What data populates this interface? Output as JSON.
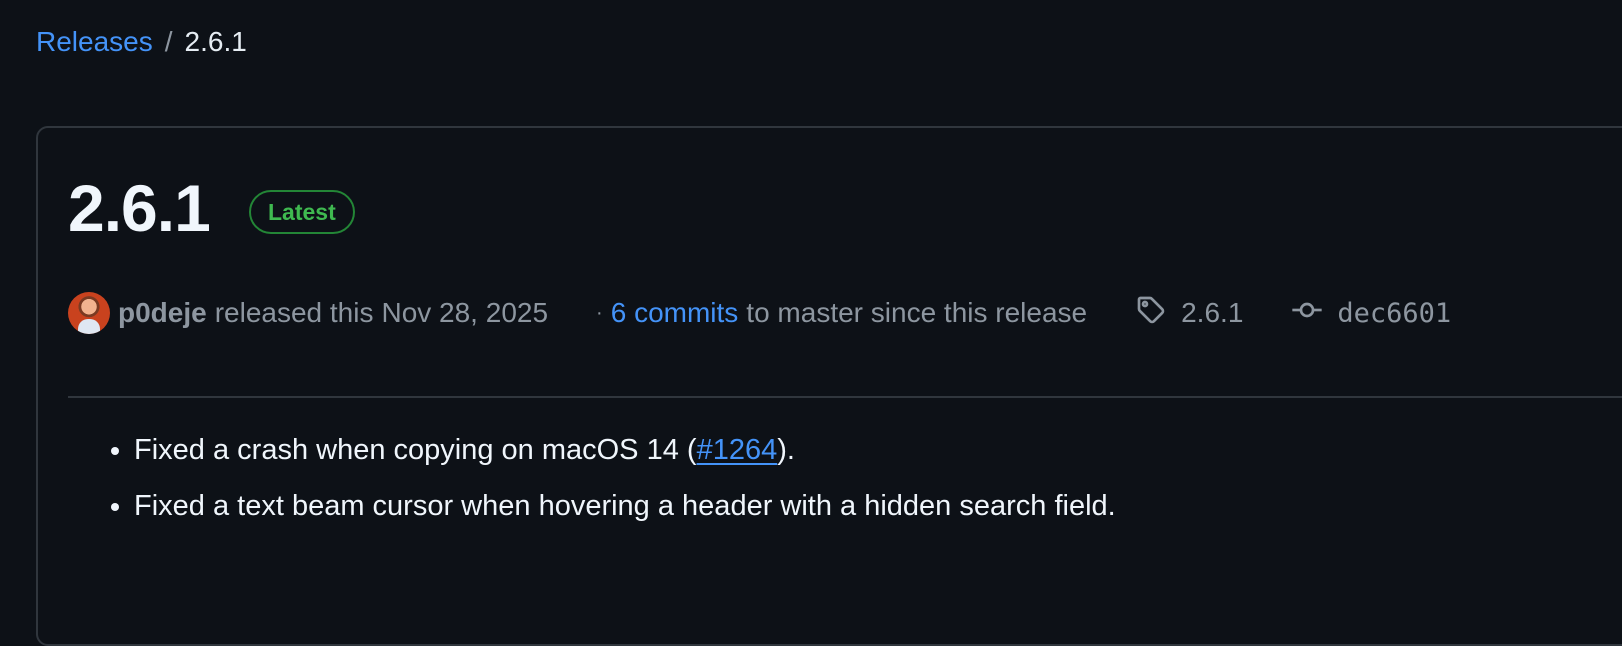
{
  "breadcrumb": {
    "link_label": "Releases",
    "separator": "/",
    "current": "2.6.1"
  },
  "release": {
    "title": "2.6.1",
    "badge": "Latest",
    "author": "p0deje",
    "released_text": "released this",
    "date": "Nov 28, 2025",
    "separator": "·",
    "commits_link": "6 commits",
    "commits_rest": "to master since this release",
    "tag": "2.6.1",
    "commit_hash": "dec6601",
    "notes": [
      {
        "before": "Fixed a crash when copying on macOS 14 (",
        "link": "#1264",
        "after": ")."
      },
      {
        "text": "Fixed a text beam cursor when hovering a header with a hidden search field."
      }
    ]
  },
  "colors": {
    "background": "#0d1117",
    "link": "#4493f8",
    "badge": "#3fb950",
    "muted_text": "#8d96a0",
    "border": "#30363d"
  },
  "icons": {
    "tag": "tag-icon",
    "commit": "git-commit-icon"
  }
}
